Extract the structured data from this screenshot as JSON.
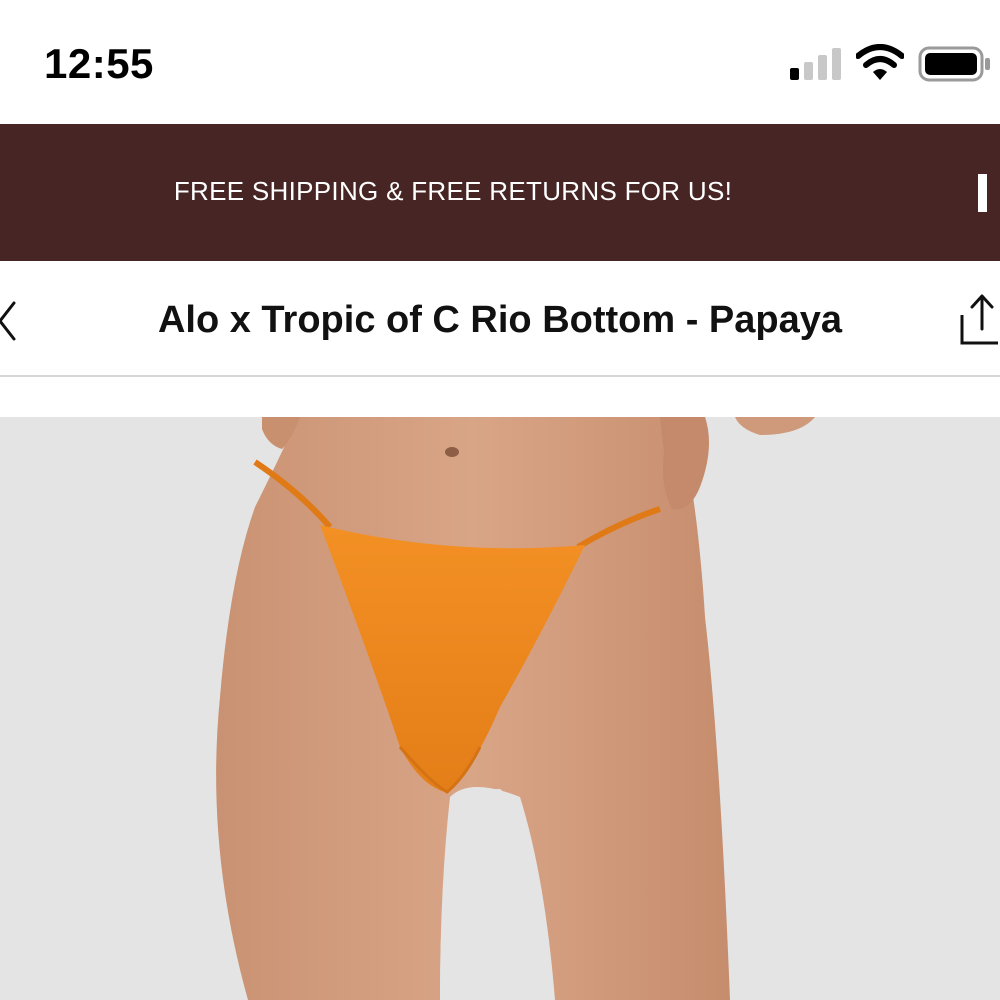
{
  "status_bar": {
    "time": "12:55",
    "signal_icon": "cellular-signal-icon",
    "wifi_icon": "wifi-icon",
    "battery_icon": "battery-icon"
  },
  "promo_banner": {
    "text": "FREE SHIPPING & FREE RETURNS FOR US!",
    "background": "#462524",
    "text_color": "#ffffff"
  },
  "nav": {
    "back_icon": "chevron-left-icon",
    "title": "Alo x Tropic of C Rio Bottom - Papaya",
    "share_icon": "share-icon"
  },
  "product_image": {
    "alt": "Alo x Tropic of C Rio Bottom - Papaya",
    "garment_color": "#f08a22",
    "backdrop_color": "#e4e4e4"
  }
}
